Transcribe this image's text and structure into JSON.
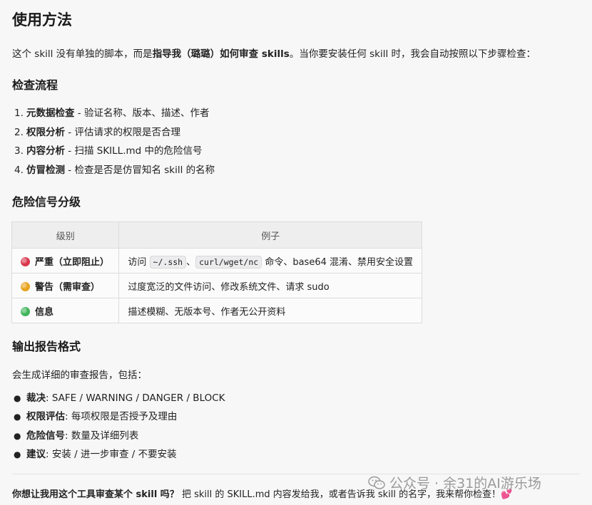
{
  "title": "使用方法",
  "intro": {
    "before": "这个 skill 没有单独的脚本，而是",
    "bold": "指导我（璐璐）如何审查 skills",
    "after": "。当你要安装任何 skill 时，我会自动按照以下步骤检查："
  },
  "check_flow": {
    "heading": "检查流程",
    "steps": [
      {
        "num": "1.",
        "label": "元数据检查",
        "desc": " - 验证名称、版本、描述、作者"
      },
      {
        "num": "2.",
        "label": "权限分析",
        "desc": " - 评估请求的权限是否合理"
      },
      {
        "num": "3.",
        "label": "内容分析",
        "desc": " - 扫描 SKILL.md 中的危险信号"
      },
      {
        "num": "4.",
        "label": "仿冒检测",
        "desc": " - 检查是否是仿冒知名 skill 的名称"
      }
    ]
  },
  "risk": {
    "heading": "危险信号分级",
    "headers": [
      "级别",
      "例子"
    ],
    "rows": [
      {
        "color": "#d9364b",
        "level": "严重（立即阻止）",
        "pre": "访问 ",
        "code1": "~/.ssh",
        "mid": "、",
        "code2": "curl/wget/nc",
        "post": " 命令、base64 混淆、禁用安全设置"
      },
      {
        "color": "#e8a21c",
        "level": "警告（需审查）",
        "text": "过度宽泛的文件访问、修改系统文件、请求 sudo"
      },
      {
        "color": "#3fb45a",
        "level": "信息",
        "text": "描述模糊、无版本号、作者无公开资料"
      }
    ]
  },
  "output": {
    "heading": "输出报告格式",
    "intro": "会生成详细的审查报告，包括：",
    "items": [
      {
        "label": "裁决",
        "desc": ": SAFE / WARNING / DANGER / BLOCK"
      },
      {
        "label": "权限评估",
        "desc": ": 每项权限是否授予及理由"
      },
      {
        "label": "危险信号",
        "desc": ": 数量及详细列表"
      },
      {
        "label": "建议",
        "desc": ": 安装 / 进一步审查 / 不要安装"
      }
    ]
  },
  "question": {
    "bold": "你想让我用这个工具审查某个 skill 吗？",
    "rest": " 把 skill 的 SKILL.md 内容发给我，或者告诉我 skill 的名字，我来帮你检查！",
    "emoji": "💕"
  },
  "watermark": "公众号 · 余31的AI游乐场",
  "icons": {
    "bullet": "bullet-dot",
    "watermark": "wechat-icon",
    "heart": "heart-icon"
  }
}
